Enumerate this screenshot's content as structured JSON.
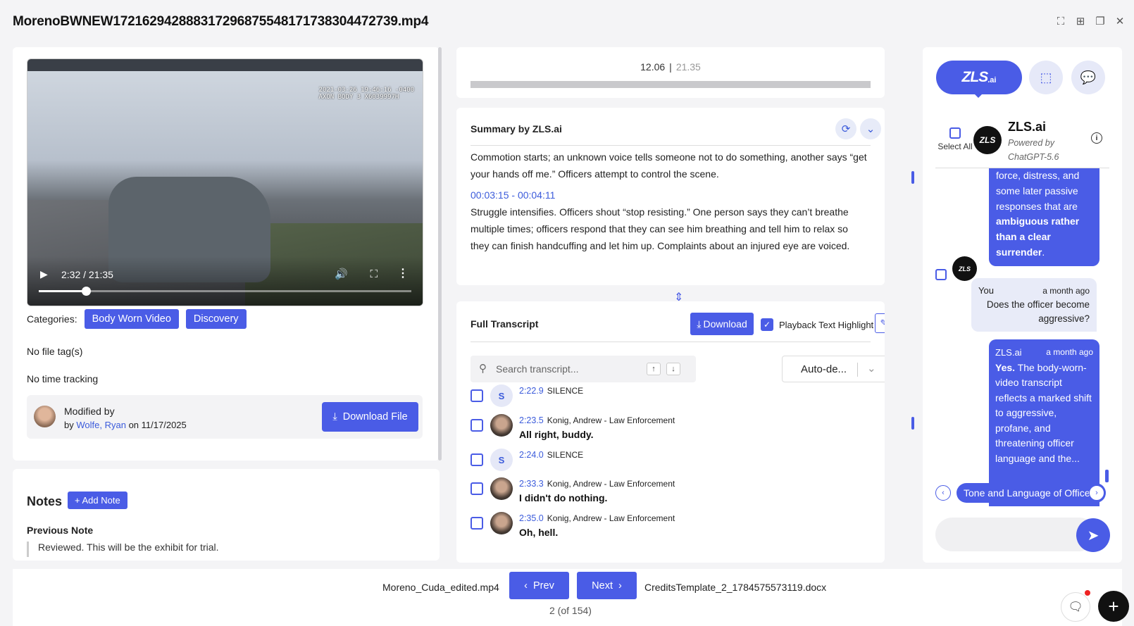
{
  "window": {
    "title": "MorenoBWNEW17216294288831729687554817173830447273​9.mp4",
    "controls": [
      "fullscreen-icon",
      "grid-icon",
      "restore-icon",
      "close-icon"
    ]
  },
  "video": {
    "stamp_line1": "2021-03-26 19:46:16 -0400",
    "stamp_line2": "AXON BODY 3 X6039997H",
    "time": "2:32 / 21:35",
    "progress": 0.127
  },
  "categories": {
    "label": "Categories:",
    "chips": [
      "Body Worn Video",
      "Discovery"
    ]
  },
  "file_tags": "No file tag(s)",
  "time_tracking": "No time tracking",
  "modified": {
    "title": "Modified by",
    "by": "by",
    "user": "Wolfe, Ryan",
    "on": "on",
    "date": "11/17/2025"
  },
  "download_file": "Download File",
  "notes": {
    "heading": "Notes",
    "add": "Add Note",
    "previous_label": "Previous Note",
    "previous_text": "Reviewed. This will be the exhibit for trial."
  },
  "timecode": {
    "current": "12.06",
    "separator": "|",
    "total": "21.35"
  },
  "summary": {
    "heading": "Summary by ZLS.ai",
    "para1": "Commotion starts; an unknown voice tells someone not to do something, another says “get your hands off me.” Officers attempt to control the scene.",
    "ts2": "00:03:15 - 00:04:11",
    "para2": "Struggle intensifies. Officers shout “stop resisting.” One person says they can’t breathe multiple times; officers respond that they can see him breathing and tell him to relax so they can finish handcuffing and let him up. Complaints about an injured eye are voiced."
  },
  "transcript": {
    "heading": "Full Transcript",
    "download": "Download",
    "playback_highlight": "Playback Text Highlight",
    "search_placeholder": "Search transcript...",
    "speaker_select": "Auto-de...",
    "rows": [
      {
        "time": "2:22.9",
        "speaker": "SILENCE",
        "text": "",
        "avatar": "S"
      },
      {
        "time": "2:23.5",
        "speaker": "Konig, Andrew - Law Enforcement",
        "text": "All right, buddy.",
        "avatar": ""
      },
      {
        "time": "2:24.0",
        "speaker": "SILENCE",
        "text": "",
        "avatar": "S"
      },
      {
        "time": "2:33.3",
        "speaker": "Konig, Andrew - Law Enforcement",
        "text": "I didn't do nothing.",
        "avatar": ""
      },
      {
        "time": "2:35.0",
        "speaker": "Konig, Andrew - Law Enforcement",
        "text": "Oh, hell.",
        "avatar": ""
      }
    ]
  },
  "assistant": {
    "logo_text": "ZLS",
    "logo_sub": ".ai",
    "select_all": "Select All",
    "name": "ZLS.ai",
    "powered1": "Powered by",
    "powered2": "ChatGPT-5.6",
    "msg1_a": "force, distress, and some later passive responses that are ",
    "msg1_b": "ambiguous rather than a clear surrender",
    "msg1_c": ".",
    "msg2_sender": "You",
    "msg2_time": "a month ago",
    "msg2_text": "Does the officer become aggressive?",
    "msg3_sender": "ZLS.ai",
    "msg3_time": "a month ago",
    "msg3_bold": "Yes.",
    "msg3_text": " The body-worn-video transcript reflects a marked shift to aggressive, profane, and threatening officer language and the...",
    "suggestion": "Tone and Language of Officer"
  },
  "footer": {
    "prev_file": "Moreno_Cuda_edited.mp4",
    "prev": "Prev",
    "next": "Next",
    "next_file": "CreditsTemplate_2_1784575573119.docx",
    "page": "2 (of 154)"
  }
}
